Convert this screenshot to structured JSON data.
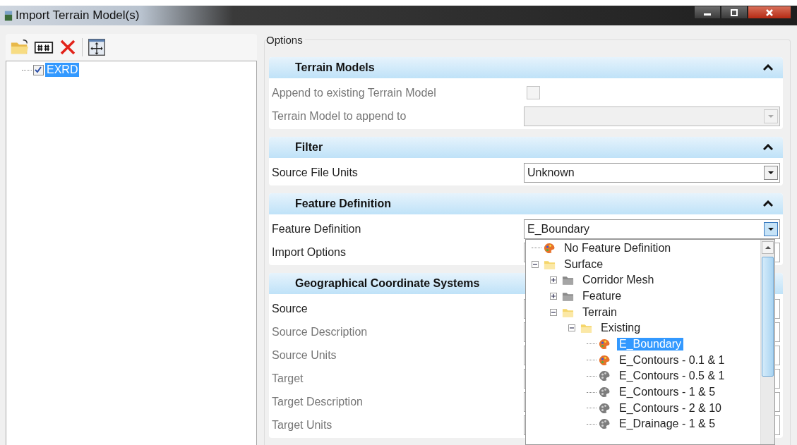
{
  "window": {
    "title": "Import Terrain Model(s)"
  },
  "file_tree": [
    {
      "label": "EXRD",
      "checked": true,
      "selected": true
    }
  ],
  "options": {
    "title": "Options",
    "sections": [
      {
        "title": "Terrain Models",
        "expanded": true,
        "rows": [
          {
            "label": "Append to existing Terrain Model",
            "kind": "checkbox",
            "disabled": true,
            "checked": false
          },
          {
            "label": "Terrain Model to append to",
            "kind": "dropdown",
            "disabled": true
          }
        ]
      },
      {
        "title": "Filter",
        "expanded": true,
        "rows": [
          {
            "label": "Source File Units",
            "kind": "dropdown",
            "disabled": false,
            "value": "Unknown"
          }
        ]
      },
      {
        "title": "Feature Definition",
        "expanded": true,
        "rows": [
          {
            "label": "Feature Definition",
            "kind": "dropdown",
            "disabled": false,
            "value": "E_Boundary",
            "open": true
          },
          {
            "label": "Import Options",
            "kind": "text",
            "disabled": false
          }
        ]
      },
      {
        "title": "Geographical Coordinate Systems",
        "rows": [
          {
            "label": "Source",
            "kind": "text",
            "disabled": false
          },
          {
            "label": "Source Description",
            "kind": "text",
            "disabled": true
          },
          {
            "label": "Source Units",
            "kind": "text",
            "disabled": true
          },
          {
            "label": "Target",
            "kind": "text",
            "disabled": true
          },
          {
            "label": "Target Description",
            "kind": "text",
            "disabled": true
          },
          {
            "label": "Target Units",
            "kind": "text",
            "disabled": true
          }
        ]
      }
    ]
  },
  "feature_picker": {
    "items": [
      {
        "label": "No Feature Definition",
        "kind": "feature",
        "active": true,
        "selected": false
      },
      {
        "label": "Surface",
        "kind": "folder",
        "active": true,
        "expanded": true,
        "selected": false,
        "children": [
          {
            "label": "Corridor Mesh",
            "kind": "folder",
            "active": false,
            "expanded": false,
            "selected": false
          },
          {
            "label": "Feature",
            "kind": "folder",
            "active": false,
            "expanded": false,
            "selected": false
          },
          {
            "label": "Terrain",
            "kind": "folder",
            "active": true,
            "expanded": true,
            "selected": false,
            "children": [
              {
                "label": "Existing",
                "kind": "folder",
                "active": true,
                "expanded": true,
                "selected": false,
                "children": [
                  {
                    "label": "E_Boundary",
                    "kind": "feature",
                    "active": true,
                    "selected": true
                  },
                  {
                    "label": "E_Contours - 0.1 & 1",
                    "kind": "feature",
                    "active": true,
                    "selected": false
                  },
                  {
                    "label": "E_Contours - 0.5 & 1",
                    "kind": "feature",
                    "active": false,
                    "selected": false
                  },
                  {
                    "label": "E_Contours - 1 & 5",
                    "kind": "feature",
                    "active": false,
                    "selected": false
                  },
                  {
                    "label": "E_Contours - 2 & 10",
                    "kind": "feature",
                    "active": false,
                    "selected": false
                  },
                  {
                    "label": "E_Drainage - 1 & 5",
                    "kind": "feature",
                    "active": false,
                    "selected": false
                  }
                ]
              }
            ]
          }
        ]
      }
    ]
  }
}
